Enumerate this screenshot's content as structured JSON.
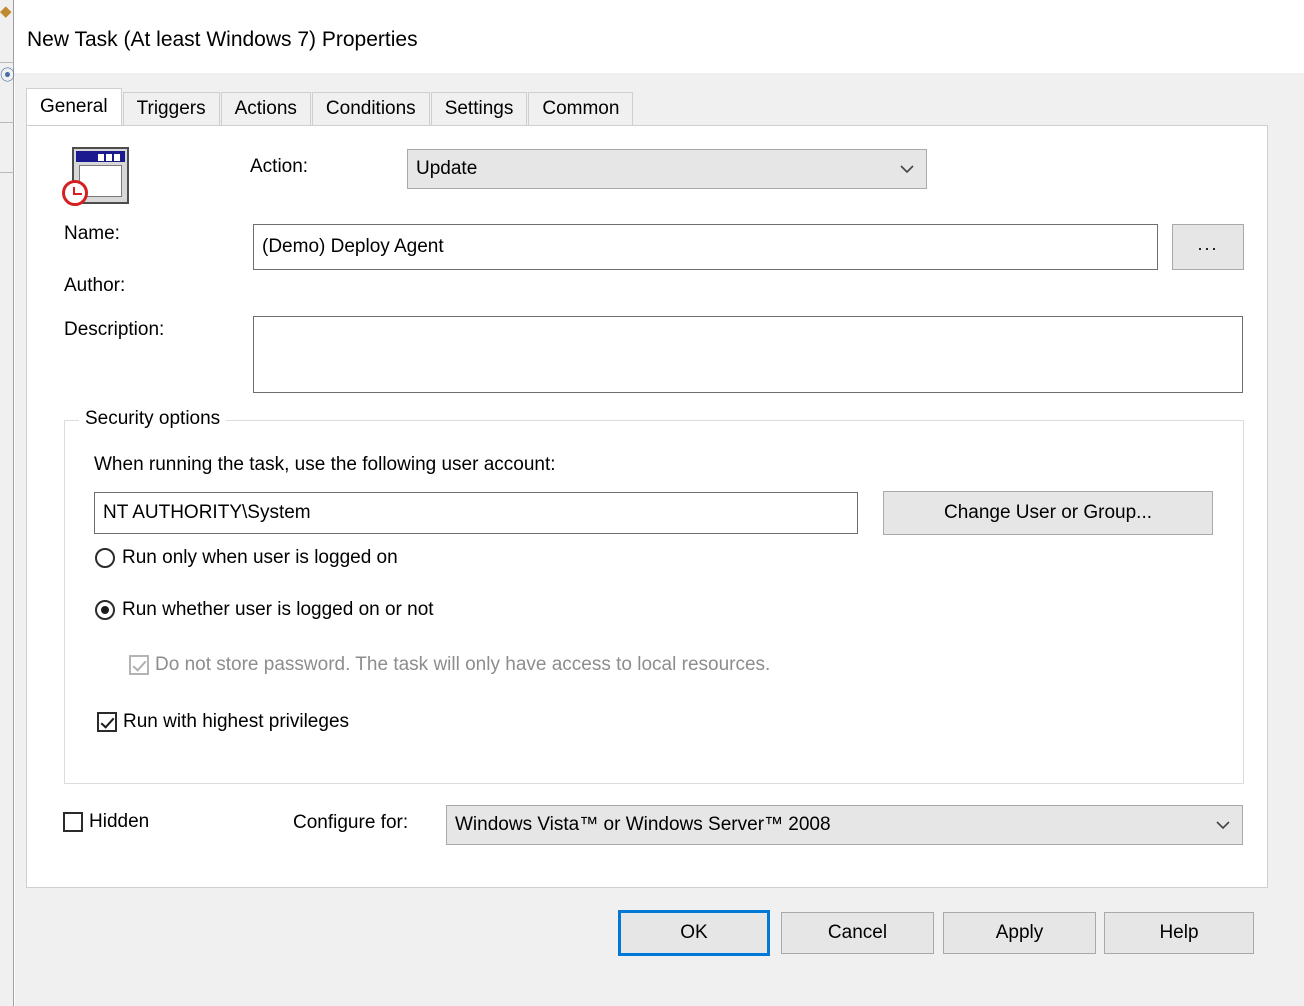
{
  "window": {
    "title": "New Task (At least Windows 7) Properties"
  },
  "tabs": [
    {
      "label": "General",
      "active": true
    },
    {
      "label": "Triggers",
      "active": false
    },
    {
      "label": "Actions",
      "active": false
    },
    {
      "label": "Conditions",
      "active": false
    },
    {
      "label": "Settings",
      "active": false
    },
    {
      "label": "Common",
      "active": false
    }
  ],
  "general": {
    "icon_name": "scheduled-task-icon",
    "action_label": "Action:",
    "action_value": "Update",
    "name_label": "Name:",
    "name_value": "(Demo) Deploy Agent",
    "browse_button": "...",
    "author_label": "Author:",
    "author_value": "",
    "description_label": "Description:",
    "description_value": ""
  },
  "security": {
    "group_title": "Security options",
    "account_prompt": "When running the task, use the following user account:",
    "account_value": "NT AUTHORITY\\System",
    "change_user_button": "Change User or Group...",
    "radio_logged_on": "Run only when user is logged on",
    "radio_logged_on_checked": false,
    "radio_whether_logged_on": "Run whether user is logged on or not",
    "radio_whether_logged_on_checked": true,
    "no_store_password": "Do not store password. The task will only have access to local resources.",
    "no_store_password_checked": true,
    "no_store_password_disabled": true,
    "highest_privileges": "Run with highest privileges",
    "highest_privileges_checked": true
  },
  "footer_options": {
    "hidden_label": "Hidden",
    "hidden_checked": false,
    "configure_for_label": "Configure for:",
    "configure_for_value": "Windows Vista™ or Windows Server™ 2008"
  },
  "buttons": {
    "ok": "OK",
    "cancel": "Cancel",
    "apply": "Apply",
    "help": "Help"
  },
  "colors": {
    "dialog_bg": "#f0f0f0",
    "panel_bg": "#ffffff",
    "accent_focus": "#0078d7",
    "control_bg": "#e6e6e6",
    "icon_titlebar": "#1b1b8f",
    "icon_badge": "#d42020"
  }
}
